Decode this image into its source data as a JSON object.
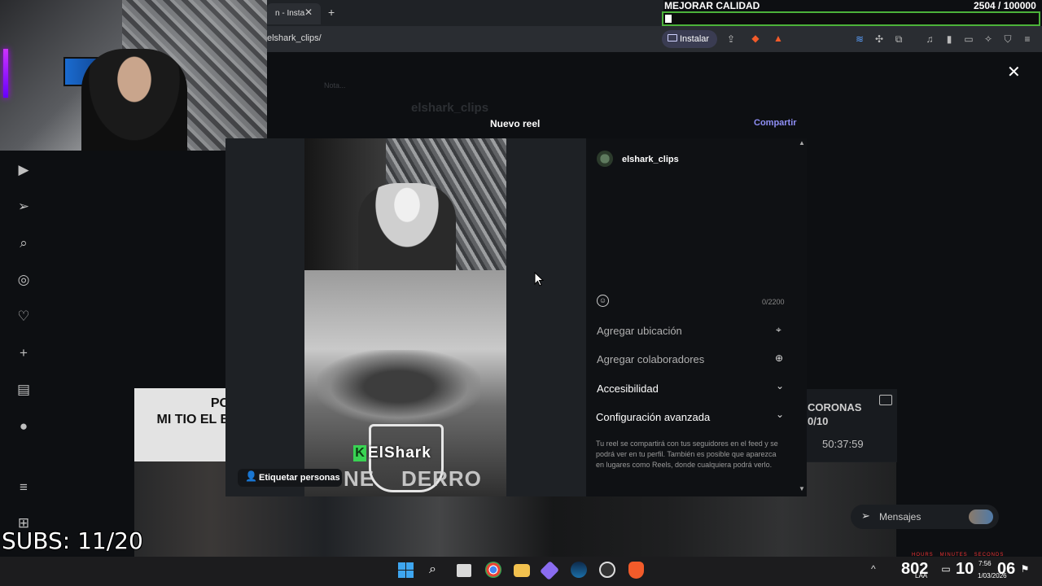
{
  "browser": {
    "tab_title": "n - Insta",
    "url": "elshark_clips/",
    "install_label": "Instalar"
  },
  "stream_overlay": {
    "goal_title": "MEJORAR CALIDAD",
    "goal_count": "2504 / 100000",
    "subs_label": "SUBS: 11/20",
    "timer_labels": "HOURS   MINUTES   SECONDS"
  },
  "background_page": {
    "note_label": "Nota...",
    "profile_name": "elshark_clips",
    "thumb_left_text": "PO\nMI TIO EL B",
    "thumb_right_title": "CORONAS",
    "thumb_right_sub": "0/10",
    "thumb_right_time": "50:37:59",
    "messages_label": "Mensajes"
  },
  "modal": {
    "title": "Nuevo reel",
    "share_label": "Compartir",
    "username": "elshark_clips",
    "char_count": "0/2200",
    "add_location": "Agregar ubicación",
    "add_collaborators": "Agregar colaboradores",
    "accessibility": "Accesibilidad",
    "advanced_settings": "Configuración avanzada",
    "disclaimer": "Tu reel se compartirá con tus seguidores en el feed y se podrá ver en tu perfil. También es posible que aparezca en lugares como Reels, donde cualquiera podrá verlo.",
    "tag_people": "Etiquetar personas",
    "video_logo_text": "ElShark",
    "video_logo_k": "K",
    "video_overlay_text": "NE    DERRO"
  },
  "taskbar": {
    "tray_number": "802",
    "tray_time": "10",
    "tray_seconds": "06",
    "clock_small": "7:56",
    "date_small": "1/03/2026",
    "lang": "LAA"
  },
  "icons": {
    "left_nav": [
      "reels-icon",
      "send-icon",
      "search-icon",
      "explore-icon",
      "heart-icon",
      "plus-icon",
      "stats-icon",
      "profile-icon",
      "menu-icon"
    ],
    "colors": {
      "goal_green": "#4cb33a",
      "share_blue": "#8f8ff5",
      "logo_green": "#39d353"
    }
  }
}
